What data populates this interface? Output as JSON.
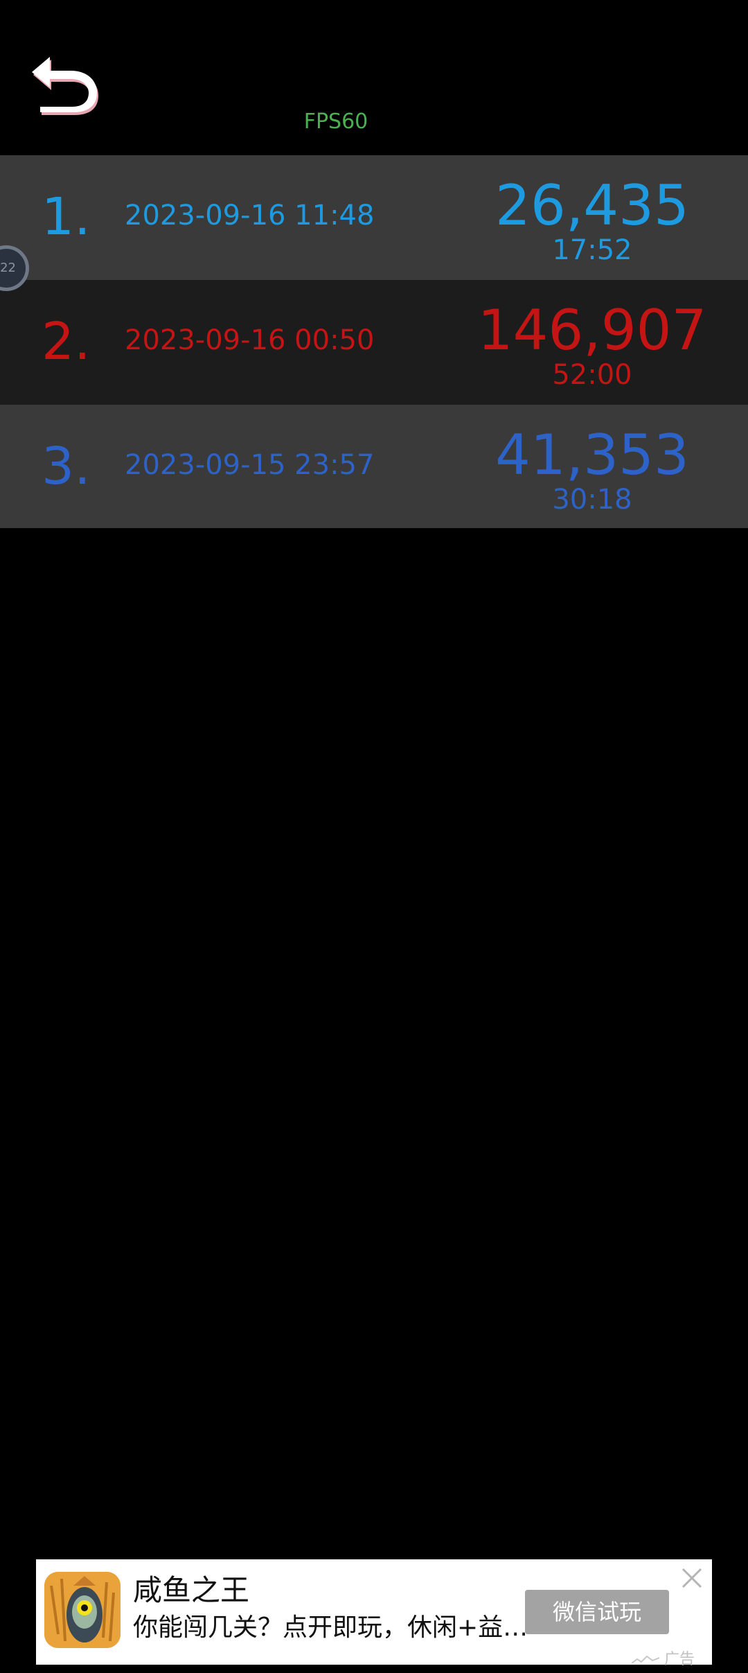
{
  "header": {
    "fps_label": "FPS60"
  },
  "side_handle": {
    "text": "22"
  },
  "scores": [
    {
      "rank": "1.",
      "date": "2023-09-16 11:48",
      "score": "26,435",
      "time": "17:52",
      "color": "#1e9be0"
    },
    {
      "rank": "2.",
      "date": "2023-09-16 00:50",
      "score": "146,907",
      "time": "52:00",
      "color": "#c41414"
    },
    {
      "rank": "3.",
      "date": "2023-09-15 23:57",
      "score": "41,353",
      "time": "30:18",
      "color": "#2d62c8"
    }
  ],
  "ad": {
    "title": "咸鱼之王",
    "description": "你能闯几关？点开即玩，休闲+益…",
    "button_label": "微信试玩",
    "tag": "广告",
    "icon": "salted-fish-king-game-icon"
  },
  "colors": {
    "background": "#000000",
    "row_light": "#3a3a3a",
    "row_dark": "#1c1c1c",
    "fps_green": "#4caf50"
  }
}
